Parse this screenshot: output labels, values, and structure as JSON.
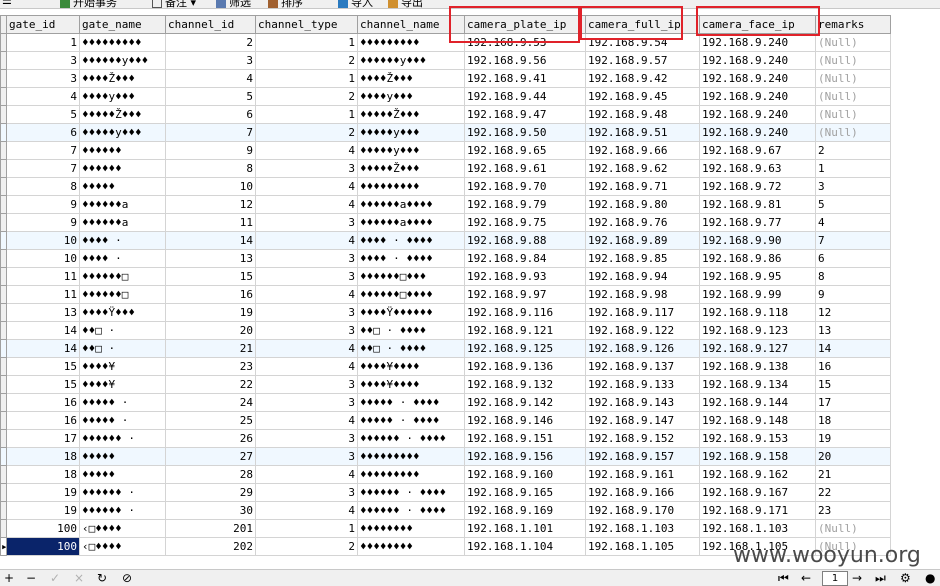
{
  "toolbar": {
    "begin_tx": "开始事务",
    "memo": "备注",
    "filter": "筛选",
    "sort": "排序",
    "import": "导入",
    "export": "导出"
  },
  "columns": [
    "gate_id",
    "gate_name",
    "channel_id",
    "channel_type",
    "channel_name",
    "camera_plate_ip",
    "camera_full_ip",
    "camera_face_ip",
    "remarks"
  ],
  "rows": [
    [
      "1",
      "♦♦♦♦♦♦♦♦♦",
      "2",
      "1",
      "♦♦♦♦♦♦♦♦♦",
      "192.168.9.53",
      "192.168.9.54",
      "192.168.9.240",
      "(Null)"
    ],
    [
      "3",
      "♦♦♦♦♦♦y♦♦♦",
      "3",
      "2",
      "♦♦♦♦♦♦y♦♦♦",
      "192.168.9.56",
      "192.168.9.57",
      "192.168.9.240",
      "(Null)"
    ],
    [
      "3",
      "♦♦♦♦Ž♦♦♦",
      "4",
      "1",
      "♦♦♦♦Ž♦♦♦",
      "192.168.9.41",
      "192.168.9.42",
      "192.168.9.240",
      "(Null)"
    ],
    [
      "4",
      "♦♦♦♦y♦♦♦",
      "5",
      "2",
      "♦♦♦♦y♦♦♦",
      "192.168.9.44",
      "192.168.9.45",
      "192.168.9.240",
      "(Null)"
    ],
    [
      "5",
      "♦♦♦♦♦Ž♦♦♦",
      "6",
      "1",
      "♦♦♦♦♦Ž♦♦♦",
      "192.168.9.47",
      "192.168.9.48",
      "192.168.9.240",
      "(Null)"
    ],
    [
      "6",
      "♦♦♦♦♦y♦♦♦",
      "7",
      "2",
      "♦♦♦♦♦y♦♦♦",
      "192.168.9.50",
      "192.168.9.51",
      "192.168.9.240",
      "(Null)"
    ],
    [
      "7",
      "♦♦♦♦♦♦",
      "9",
      "4",
      "♦♦♦♦♦y♦♦♦",
      "192.168.9.65",
      "192.168.9.66",
      "192.168.9.67",
      "2"
    ],
    [
      "7",
      "♦♦♦♦♦♦",
      "8",
      "3",
      "♦♦♦♦♦Ž♦♦♦",
      "192.168.9.61",
      "192.168.9.62",
      "192.168.9.63",
      "1"
    ],
    [
      "8",
      "♦♦♦♦♦",
      "10",
      "4",
      "♦♦♦♦♦♦♦♦♦",
      "192.168.9.70",
      "192.168.9.71",
      "192.168.9.72",
      "3"
    ],
    [
      "9",
      "♦♦♦♦♦♦a",
      "12",
      "4",
      "♦♦♦♦♦♦a♦♦♦♦",
      "192.168.9.79",
      "192.168.9.80",
      "192.168.9.81",
      "5"
    ],
    [
      "9",
      "♦♦♦♦♦♦a",
      "11",
      "3",
      "♦♦♦♦♦♦a♦♦♦♦",
      "192.168.9.75",
      "192.168.9.76",
      "192.168.9.77",
      "4"
    ],
    [
      "10",
      "♦♦♦♦ ·",
      "14",
      "4",
      "♦♦♦♦ · ♦♦♦♦",
      "192.168.9.88",
      "192.168.9.89",
      "192.168.9.90",
      "7"
    ],
    [
      "10",
      "♦♦♦♦ ·",
      "13",
      "3",
      "♦♦♦♦ · ♦♦♦♦",
      "192.168.9.84",
      "192.168.9.85",
      "192.168.9.86",
      "6"
    ],
    [
      "11",
      "♦♦♦♦♦♦□",
      "15",
      "3",
      "♦♦♦♦♦♦□♦♦♦",
      "192.168.9.93",
      "192.168.9.94",
      "192.168.9.95",
      "8"
    ],
    [
      "11",
      "♦♦♦♦♦♦□",
      "16",
      "4",
      "♦♦♦♦♦♦□♦♦♦♦",
      "192.168.9.97",
      "192.168.9.98",
      "192.168.9.99",
      "9"
    ],
    [
      "13",
      "♦♦♦♦Ÿ♦♦♦",
      "19",
      "3",
      "♦♦♦♦Ÿ♦♦♦♦♦♦",
      "192.168.9.116",
      "192.168.9.117",
      "192.168.9.118",
      "12"
    ],
    [
      "14",
      "♦♦□ ·",
      "20",
      "3",
      "♦♦□ · ♦♦♦♦",
      "192.168.9.121",
      "192.168.9.122",
      "192.168.9.123",
      "13"
    ],
    [
      "14",
      "♦♦□ ·",
      "21",
      "4",
      "♦♦□ · ♦♦♦♦",
      "192.168.9.125",
      "192.168.9.126",
      "192.168.9.127",
      "14"
    ],
    [
      "15",
      "♦♦♦♦¥",
      "23",
      "4",
      "♦♦♦♦¥♦♦♦♦",
      "192.168.9.136",
      "192.168.9.137",
      "192.168.9.138",
      "16"
    ],
    [
      "15",
      "♦♦♦♦¥",
      "22",
      "3",
      "♦♦♦♦¥♦♦♦♦",
      "192.168.9.132",
      "192.168.9.133",
      "192.168.9.134",
      "15"
    ],
    [
      "16",
      "♦♦♦♦♦ ·",
      "24",
      "3",
      "♦♦♦♦♦ · ♦♦♦♦",
      "192.168.9.142",
      "192.168.9.143",
      "192.168.9.144",
      "17"
    ],
    [
      "16",
      "♦♦♦♦♦ ·",
      "25",
      "4",
      "♦♦♦♦♦ · ♦♦♦♦",
      "192.168.9.146",
      "192.168.9.147",
      "192.168.9.148",
      "18"
    ],
    [
      "17",
      "♦♦♦♦♦♦ ·",
      "26",
      "3",
      "♦♦♦♦♦♦ · ♦♦♦♦",
      "192.168.9.151",
      "192.168.9.152",
      "192.168.9.153",
      "19"
    ],
    [
      "18",
      "♦♦♦♦♦",
      "27",
      "3",
      "♦♦♦♦♦♦♦♦♦",
      "192.168.9.156",
      "192.168.9.157",
      "192.168.9.158",
      "20"
    ],
    [
      "18",
      "♦♦♦♦♦",
      "28",
      "4",
      "♦♦♦♦♦♦♦♦♦",
      "192.168.9.160",
      "192.168.9.161",
      "192.168.9.162",
      "21"
    ],
    [
      "19",
      "♦♦♦♦♦♦ ·",
      "29",
      "3",
      "♦♦♦♦♦♦ · ♦♦♦♦",
      "192.168.9.165",
      "192.168.9.166",
      "192.168.9.167",
      "22"
    ],
    [
      "19",
      "♦♦♦♦♦♦ ·",
      "30",
      "4",
      "♦♦♦♦♦♦ · ♦♦♦♦",
      "192.168.9.169",
      "192.168.9.170",
      "192.168.9.171",
      "23"
    ],
    [
      "100",
      "‹□♦♦♦♦",
      "201",
      "1",
      "♦♦♦♦♦♦♦♦",
      "192.168.1.101",
      "192.168.1.103",
      "192.168.1.103",
      "(Null)"
    ],
    [
      "100",
      "‹□♦♦♦♦",
      "202",
      "2",
      "♦♦♦♦♦♦♦♦",
      "192.168.1.104",
      "192.168.1.105",
      "192.168.1.105",
      "(Null)"
    ]
  ],
  "alt_rows": [
    5,
    11,
    17,
    23
  ],
  "selected_row": 28,
  "status": {
    "page": "1",
    "watermark": "www.wooyun.org"
  },
  "colors": {
    "highlight": "#e0222a",
    "selection": "#0a246a",
    "alt_row": "#f0f8ff",
    "null_text": "#a0a0a0"
  }
}
